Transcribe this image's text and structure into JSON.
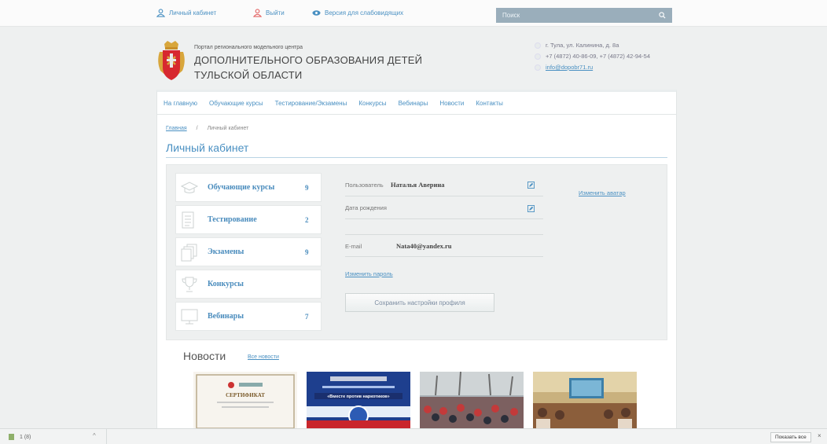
{
  "topbar": {
    "cabinet": "Личный кабинет",
    "logout": "Выйти",
    "accessibility": "Версия для слабовидящих",
    "search_placeholder": "Поиск"
  },
  "header": {
    "subtitle": "Портал регионального модельного центра",
    "title_line1": "ДОПОЛНИТЕЛЬНОГО ОБРАЗОВАНИЯ ДЕТЕЙ",
    "title_line2": "ТУЛЬСКОЙ ОБЛАСТИ",
    "address": "г. Тула, ул. Калинина, д. 8а",
    "phones": "+7 (4872) 40-86-09, +7 (4872) 42-94-54",
    "email": "info@dopobr71.ru"
  },
  "nav": [
    "На главную",
    "Обучающие курсы",
    "Тестирование/Экзамены",
    "Конкурсы",
    "Вебинары",
    "Новости",
    "Контакты"
  ],
  "breadcrumb": {
    "home": "Главная",
    "current": "Личный кабинет"
  },
  "page_title": "Личный кабинет",
  "menu": [
    {
      "label": "Обучающие курсы",
      "count": "9",
      "icon": "graduation-cap-icon"
    },
    {
      "label": "Тестирование",
      "count": "2",
      "icon": "checklist-icon"
    },
    {
      "label": "Экзамены",
      "count": "9",
      "icon": "documents-icon"
    },
    {
      "label": "Конкурсы",
      "count": "",
      "icon": "trophy-icon"
    },
    {
      "label": "Вебинары",
      "count": "7",
      "icon": "monitor-icon"
    }
  ],
  "profile": {
    "user_label": "Пользователь",
    "user_value": "Наталья Аверина",
    "birth_label": "Дата рождения",
    "birth_value": "",
    "email_label": "E-mail",
    "email_value": "Nata40@yandex.ru",
    "change_avatar": "Изменить аватар",
    "change_password": "Изменить пароль",
    "save_button": "Сохранить настройки профиля"
  },
  "news": {
    "title": "Новости",
    "all_link": "Все новости",
    "thumb_texts": [
      "СЕРТИФИКАТ",
      "«Вместе против наркотиков»"
    ]
  },
  "colors": {
    "accent": "#4a90c2",
    "search_bg": "#9aaebb",
    "panel_bg": "#eef0f0"
  },
  "downloads": {
    "item": "1 (8)",
    "show_all": "Показать все",
    "close": "×"
  }
}
